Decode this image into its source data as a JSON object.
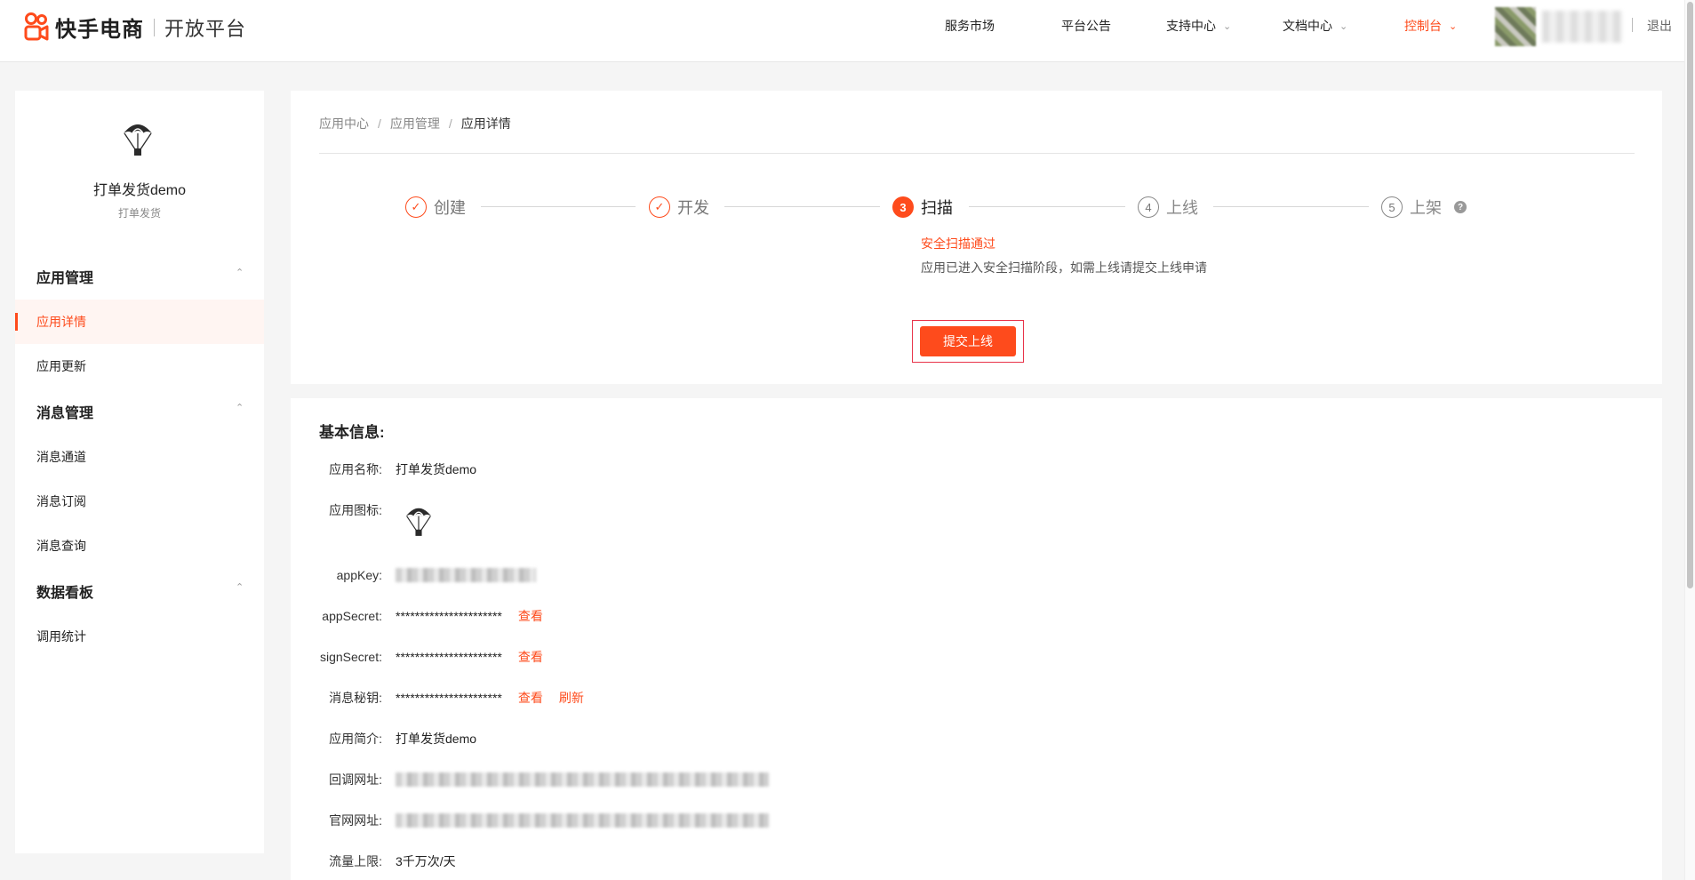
{
  "header": {
    "brand": "快手电商",
    "subtitle": "开放平台",
    "nav": [
      {
        "label": "服务市场",
        "has_dropdown": false,
        "active": false
      },
      {
        "label": "平台公告",
        "has_dropdown": false,
        "active": false
      },
      {
        "label": "支持中心",
        "has_dropdown": true,
        "active": false
      },
      {
        "label": "文档中心",
        "has_dropdown": true,
        "active": false
      },
      {
        "label": "控制台",
        "has_dropdown": true,
        "active": true
      }
    ],
    "logout": "退出"
  },
  "sidebar": {
    "app_name": "打单发货demo",
    "app_subtitle": "打单发货",
    "groups": [
      {
        "title": "应用管理",
        "items": [
          "应用详情",
          "应用更新"
        ]
      },
      {
        "title": "消息管理",
        "items": [
          "消息通道",
          "消息订阅",
          "消息查询"
        ]
      },
      {
        "title": "数据看板",
        "items": [
          "调用统计"
        ]
      }
    ],
    "active_item": "应用详情"
  },
  "breadcrumb": [
    "应用中心",
    "应用管理",
    "应用详情"
  ],
  "steps": [
    {
      "num": "1",
      "label": "创建",
      "state": "done"
    },
    {
      "num": "2",
      "label": "开发",
      "state": "done"
    },
    {
      "num": "3",
      "label": "扫描",
      "state": "current"
    },
    {
      "num": "4",
      "label": "上线",
      "state": "todo"
    },
    {
      "num": "5",
      "label": "上架",
      "state": "todo"
    }
  ],
  "step_status": "安全扫描通过",
  "step_desc": "应用已进入安全扫描阶段，如需上线请提交上线申请",
  "submit_label": "提交上线",
  "help_glyph": "?",
  "check_glyph": "✓",
  "info": {
    "title": "基本信息:",
    "labels": {
      "name": "应用名称:",
      "icon": "应用图标:",
      "app_key": "appKey:",
      "app_secret": "appSecret:",
      "sign_secret": "signSecret:",
      "msg_key": "消息秘钥:",
      "intro": "应用简介:",
      "callback": "回调网址:",
      "website": "官网网址:",
      "rate": "流量上限:"
    },
    "values": {
      "name": "打单发货demo",
      "app_secret": "**********************",
      "sign_secret": "**********************",
      "msg_key": "**********************",
      "intro": "打单发货demo",
      "rate": "3千万次/天"
    },
    "view_label": "查看",
    "refresh_label": "刷新"
  },
  "colors": {
    "accent": "#fe4b1c",
    "highlight_border": "#e8344a"
  }
}
